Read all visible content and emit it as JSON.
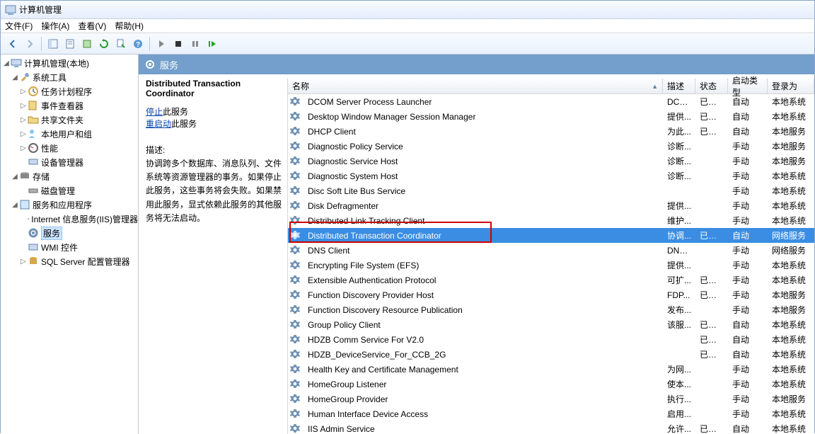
{
  "title": "计算机管理",
  "menu": {
    "file": "文件(F)",
    "action": "操作(A)",
    "view": "查看(V)",
    "help": "帮助(H)"
  },
  "tree": {
    "root": "计算机管理(本地)",
    "system_tools": "系统工具",
    "task_scheduler": "任务计划程序",
    "event_viewer": "事件查看器",
    "shared_folders": "共享文件夹",
    "local_users": "本地用户和组",
    "performance": "性能",
    "device_manager": "设备管理器",
    "storage": "存储",
    "disk_management": "磁盘管理",
    "services_apps": "服务和应用程序",
    "iis": "Internet 信息服务(IIS)管理器",
    "services": "服务",
    "wmi": "WMI 控件",
    "sql": "SQL Server 配置管理器"
  },
  "header": {
    "services": "服务"
  },
  "detail": {
    "name": "Distributed Transaction Coordinator",
    "stop": "停止",
    "stop_suffix": "此服务",
    "restart": "重启动",
    "restart_suffix": "此服务",
    "desc_label": "描述:",
    "desc_text": "协调跨多个数据库、消息队列、文件系统等资源管理器的事务。如果停止此服务，这些事务将会失败。如果禁用此服务，显式依赖此服务的其他服务将无法启动。"
  },
  "columns": {
    "name": "名称",
    "desc": "描述",
    "status": "状态",
    "startup": "启动类型",
    "account": "登录为"
  },
  "services": [
    {
      "name": "DCOM Server Process Launcher",
      "desc": "DCO...",
      "status": "已启动",
      "startup": "自动",
      "account": "本地系统"
    },
    {
      "name": "Desktop Window Manager Session Manager",
      "desc": "提供...",
      "status": "已启动",
      "startup": "自动",
      "account": "本地系统"
    },
    {
      "name": "DHCP Client",
      "desc": "为此...",
      "status": "已启动",
      "startup": "自动",
      "account": "本地服务"
    },
    {
      "name": "Diagnostic Policy Service",
      "desc": "诊断...",
      "status": "",
      "startup": "手动",
      "account": "本地服务"
    },
    {
      "name": "Diagnostic Service Host",
      "desc": "诊断...",
      "status": "",
      "startup": "手动",
      "account": "本地服务"
    },
    {
      "name": "Diagnostic System Host",
      "desc": "诊断...",
      "status": "",
      "startup": "手动",
      "account": "本地系统"
    },
    {
      "name": "Disc Soft Lite Bus Service",
      "desc": "",
      "status": "",
      "startup": "手动",
      "account": "本地系统"
    },
    {
      "name": "Disk Defragmenter",
      "desc": "提供...",
      "status": "",
      "startup": "手动",
      "account": "本地系统"
    },
    {
      "name": "Distributed Link Tracking Client",
      "desc": "维护...",
      "status": "",
      "startup": "手动",
      "account": "本地系统"
    },
    {
      "name": "Distributed Transaction Coordinator",
      "desc": "协调...",
      "status": "已启动",
      "startup": "自动",
      "account": "网络服务",
      "selected": true
    },
    {
      "name": "DNS Client",
      "desc": "DNS...",
      "status": "",
      "startup": "手动",
      "account": "网络服务"
    },
    {
      "name": "Encrypting File System (EFS)",
      "desc": "提供...",
      "status": "",
      "startup": "手动",
      "account": "本地系统"
    },
    {
      "name": "Extensible Authentication Protocol",
      "desc": "可扩...",
      "status": "已启动",
      "startup": "手动",
      "account": "本地系统"
    },
    {
      "name": "Function Discovery Provider Host",
      "desc": "FDP...",
      "status": "已启动",
      "startup": "手动",
      "account": "本地服务"
    },
    {
      "name": "Function Discovery Resource Publication",
      "desc": "发布...",
      "status": "",
      "startup": "手动",
      "account": "本地服务"
    },
    {
      "name": "Group Policy Client",
      "desc": "该服...",
      "status": "已启动",
      "startup": "自动",
      "account": "本地系统"
    },
    {
      "name": "HDZB Comm Service For V2.0",
      "desc": "",
      "status": "已启动",
      "startup": "自动",
      "account": "本地系统"
    },
    {
      "name": "HDZB_DeviceService_For_CCB_2G",
      "desc": "",
      "status": "已启动",
      "startup": "自动",
      "account": "本地系统"
    },
    {
      "name": "Health Key and Certificate Management",
      "desc": "为网...",
      "status": "",
      "startup": "手动",
      "account": "本地系统"
    },
    {
      "name": "HomeGroup Listener",
      "desc": "使本...",
      "status": "",
      "startup": "手动",
      "account": "本地系统"
    },
    {
      "name": "HomeGroup Provider",
      "desc": "执行...",
      "status": "",
      "startup": "手动",
      "account": "本地服务"
    },
    {
      "name": "Human Interface Device Access",
      "desc": "启用...",
      "status": "",
      "startup": "手动",
      "account": "本地系统"
    },
    {
      "name": "IIS Admin Service",
      "desc": "允许...",
      "status": "已启动",
      "startup": "自动",
      "account": "本地系统"
    }
  ]
}
